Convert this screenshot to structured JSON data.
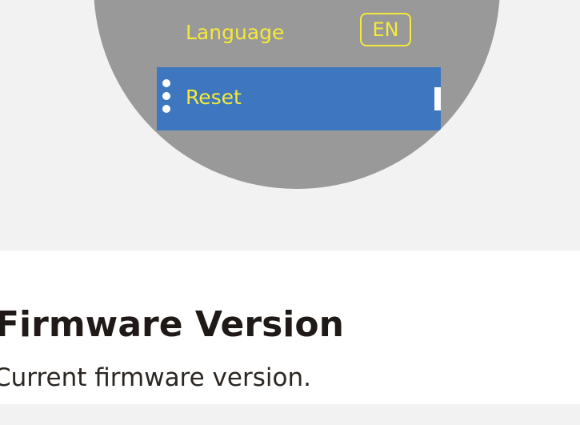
{
  "device_menu": {
    "language": {
      "label": "Language",
      "value": "EN"
    },
    "reset": {
      "label": "Reset"
    }
  },
  "section": {
    "title": "Firmware Version",
    "description": "Current firmware version."
  },
  "colors": {
    "panel_background": "#f2f2f2",
    "device_screen": "#999999",
    "menu_text": "#f5e93a",
    "selected_row": "#3e77bf"
  },
  "icons": {
    "reset_row": "more-vertical-icon"
  }
}
